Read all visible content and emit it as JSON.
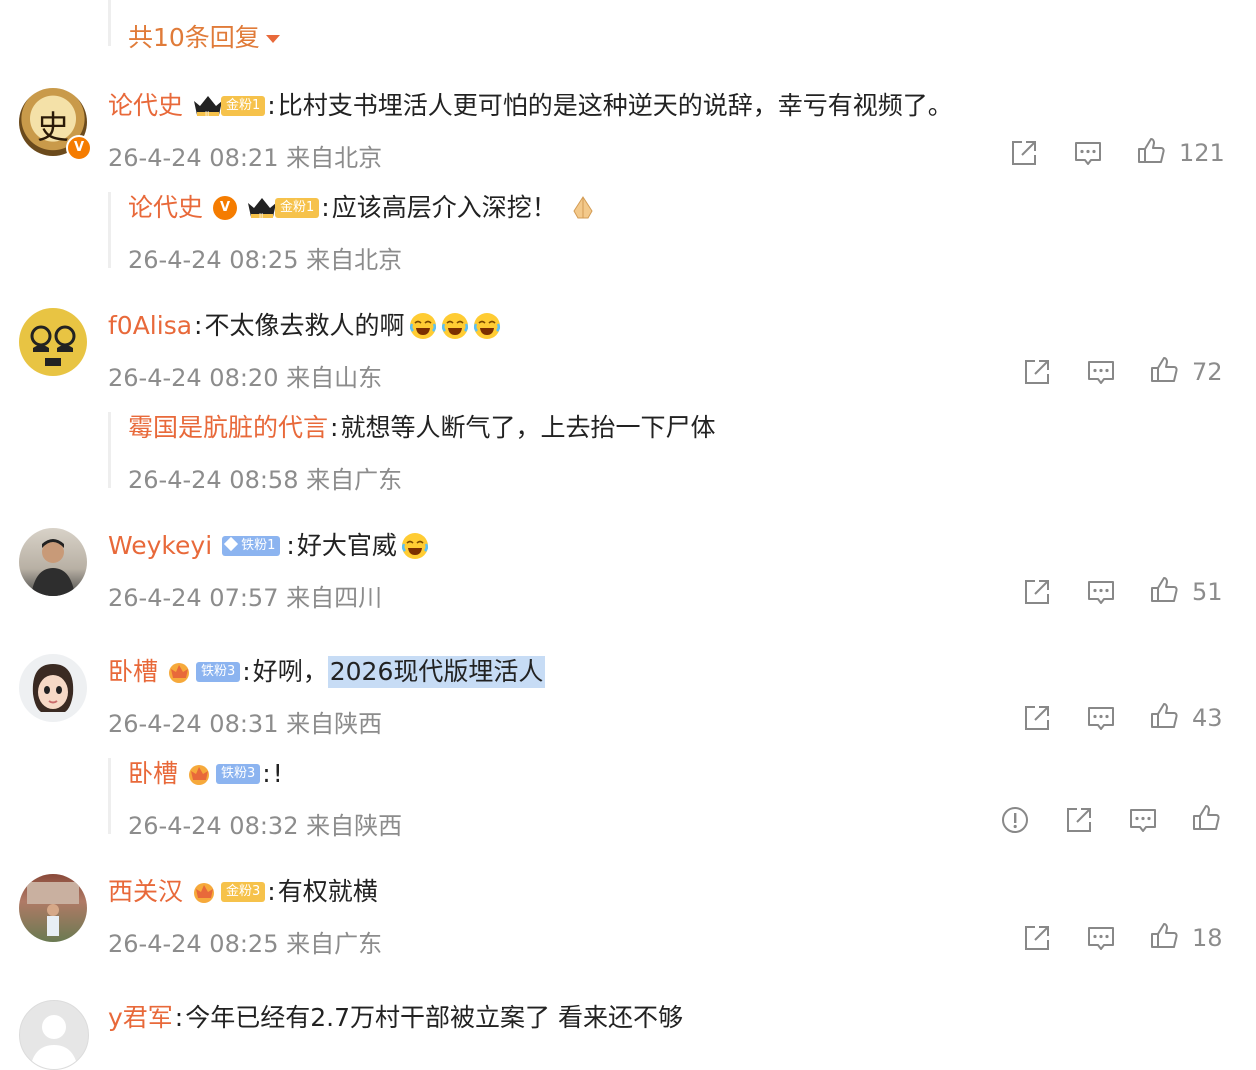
{
  "top_reply_link": "共10条回复",
  "comments": [
    {
      "user": "论代史",
      "badge": "金粉1",
      "text": "比村支书埋活人更可怕的是这种逆天的说辞，幸亏有视频了。",
      "meta": "26-4-24 08:21 来自北京",
      "likes": "121",
      "reply": {
        "user": "论代史",
        "badge": "金粉1",
        "text": "应该高层介入深挖！",
        "meta": "26-4-24 08:25 来自北京"
      }
    },
    {
      "user": "f0Alisa",
      "text": "不太像去救人的啊",
      "meta": "26-4-24 08:20 来自山东",
      "likes": "72",
      "reply": {
        "user": "霉国是肮脏的代言",
        "text": "就想等人断气了，上去抬一下尸体",
        "meta": "26-4-24 08:58 来自广东"
      }
    },
    {
      "user": "Weykeyi",
      "badge": "铁粉1",
      "text": "好大官威",
      "meta": "26-4-24 07:57 来自四川",
      "likes": "51"
    },
    {
      "user": "卧槽",
      "badge": "铁粉3",
      "text_prefix": "好咧，",
      "text_highlight": "2026现代版埋活人",
      "meta": "26-4-24 08:31 来自陕西",
      "likes": "43",
      "reply": {
        "user": "卧槽",
        "badge": "铁粉3",
        "text": "!",
        "meta": "26-4-24 08:32 来自陕西"
      }
    },
    {
      "user": "西关汉",
      "badge": "金粉3",
      "text": "有权就横",
      "meta": "26-4-24 08:25 来自广东",
      "likes": "18"
    },
    {
      "user": "y君军",
      "text": "今年已经有2.7万村干部被立案了 看来还不够"
    }
  ],
  "icons": [
    "share-icon",
    "comment-icon",
    "like-icon",
    "report-icon",
    "crying-laughing-emoji",
    "folded-hands-emoji"
  ],
  "colors": {
    "username": "#e8693a",
    "meta": "#8c8c8c",
    "highlight": "#c7dcf5",
    "gold_badge": "#f6c24b",
    "iron_badge": "#8cb4f0"
  }
}
